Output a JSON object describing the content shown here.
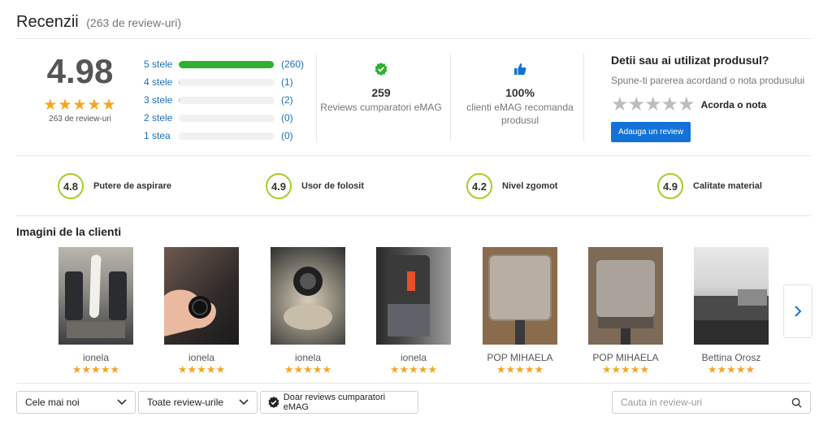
{
  "header": {
    "title": "Recenzii",
    "count_text": "(263 de review-uri)"
  },
  "summary": {
    "average": "4.98",
    "stars": "★★★★★",
    "review_count": "263 de review-uri",
    "distribution": [
      {
        "label": "5 stele",
        "count": "(260)",
        "fraction": 0.989
      },
      {
        "label": "4 stele",
        "count": "(1)",
        "fraction": 0.004
      },
      {
        "label": "3 stele",
        "count": "(2)",
        "fraction": 0.008
      },
      {
        "label": "2 stele",
        "count": "(0)",
        "fraction": 0
      },
      {
        "label": "1 stea",
        "count": "(0)",
        "fraction": 0
      }
    ]
  },
  "stats": [
    {
      "icon": "verified-check-icon",
      "value": "259",
      "label": "Reviews cumparatori eMAG"
    },
    {
      "icon": "thumbs-up-icon",
      "value": "100%",
      "label": "clienti eMAG recomanda produsul"
    }
  ],
  "owned": {
    "title": "Detii sau ai utilizat produsul?",
    "prompt": "Spune-ti parerea acordand o nota produsului",
    "stars": "★★★★★",
    "rate_label": "Acorda o nota",
    "button": "Adauga un review"
  },
  "criteria": [
    {
      "score": "4.8",
      "name": "Putere de aspirare"
    },
    {
      "score": "4.9",
      "name": "Usor de folosit"
    },
    {
      "score": "4.2",
      "name": "Nivel zgomot"
    },
    {
      "score": "4.9",
      "name": "Calitate material"
    }
  ],
  "images": {
    "title": "Imagini de la clienti",
    "tiles": [
      {
        "author": "ionela",
        "stars": "★★★★★"
      },
      {
        "author": "ionela",
        "stars": "★★★★★"
      },
      {
        "author": "ionela",
        "stars": "★★★★★"
      },
      {
        "author": "ionela",
        "stars": "★★★★★"
      },
      {
        "author": "POP MIHAELA",
        "stars": "★★★★★"
      },
      {
        "author": "POP MIHAELA",
        "stars": "★★★★★"
      },
      {
        "author": "Bettina Orosz",
        "stars": "★★★★★"
      }
    ]
  },
  "filters": {
    "sort": "Cele mai noi",
    "type": "Toate review-urile",
    "verified": "Doar reviews cumparatori eMAG",
    "search_placeholder": "Cauta in review-uri"
  },
  "colors": {
    "accent": "#1272d8",
    "bar_green": "#2fb12f",
    "star": "#f5a623",
    "criteria_ring": "#a4cf2a"
  }
}
